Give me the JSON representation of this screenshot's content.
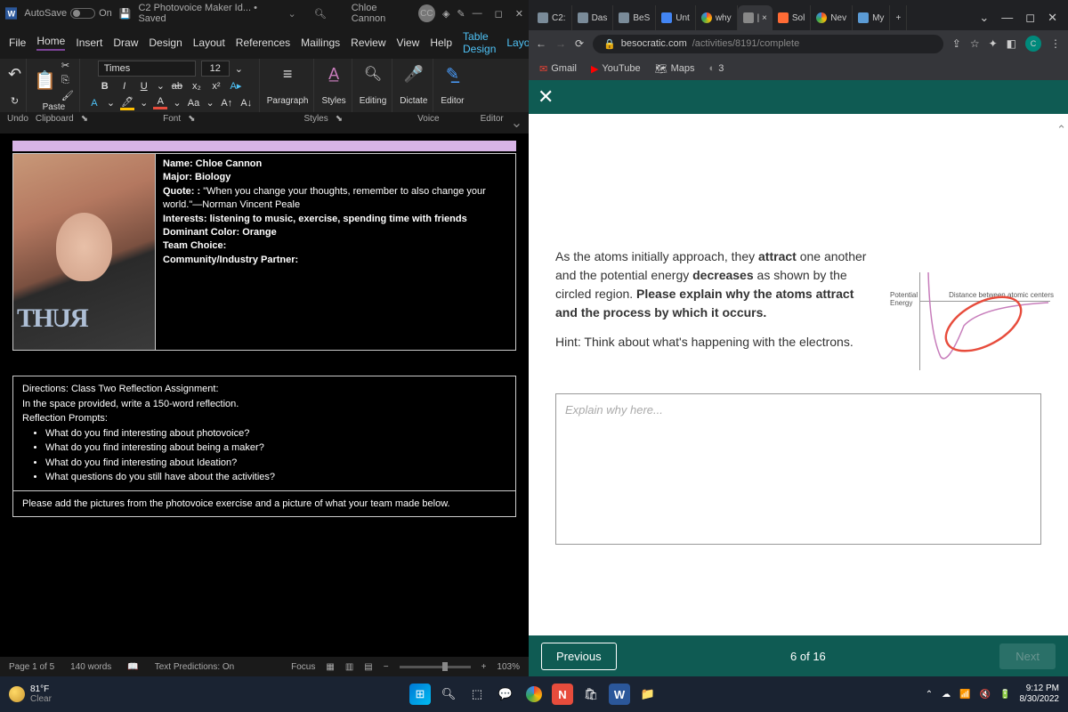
{
  "word": {
    "titlebar": {
      "autosave_label": "AutoSave",
      "autosave_state": "On",
      "doc_title": "C2 Photovoice Maker Id... • Saved",
      "user": "Chloe Cannon",
      "initials": "CC"
    },
    "menu": [
      "File",
      "Home",
      "Insert",
      "Draw",
      "Design",
      "Layout",
      "References",
      "Mailings",
      "Review",
      "View",
      "Help",
      "Table Design",
      "Layout"
    ],
    "active_tab": "Home",
    "font": {
      "name": "Times",
      "size": "12"
    },
    "ribbon_groups": [
      "Paste",
      "Paragraph",
      "Styles",
      "Editing",
      "Dictate",
      "Editor"
    ],
    "group_labels": [
      "Undo",
      "Clipboard",
      "Font",
      "Styles",
      "Voice",
      "Editor"
    ],
    "doc": {
      "name_line": "Name: Chloe Cannon",
      "major_line": "Major: Biology",
      "quote_label": "Quote: :",
      "quote_text": "\"When you change your thoughts, remember to also change your world.\"—Norman Vincent Peale",
      "interests": "Interests: listening to music, exercise, spending time with friends",
      "color": "Dominant Color: Orange",
      "team": "Team Choice:",
      "partner": "Community/Industry Partner:",
      "shirt_text": "RUHT",
      "directions_title": "Directions: Class Two Reflection Assignment:",
      "directions_sub": "In the space provided, write a 150-word reflection.",
      "prompts_label": "Reflection Prompts:",
      "prompts": [
        "What do you find interesting about photovoice?",
        "What do you find interesting about being a maker?",
        "What do you find interesting about Ideation?",
        "What questions do you still have about the activities?"
      ],
      "below": "Please add the pictures from the photovoice exercise and a picture of what your team made below."
    },
    "status": {
      "page": "Page 1 of 5",
      "words": "140 words",
      "predictions": "Text Predictions: On",
      "focus": "Focus",
      "zoom": "103%"
    }
  },
  "chrome": {
    "tabs": [
      {
        "label": "C2:",
        "fav": "#7a8b99"
      },
      {
        "label": "Das",
        "fav": "#7a8b99"
      },
      {
        "label": "BeS",
        "fav": "#7a8b99"
      },
      {
        "label": "Unt",
        "fav": "#4285f4"
      },
      {
        "label": "why",
        "fav": "#ea4335",
        "g": true
      },
      {
        "label": "| ×",
        "fav": "#888"
      },
      {
        "label": "Sol",
        "fav": "#ff6b35"
      },
      {
        "label": "Nev",
        "fav": "#ea4335",
        "g": true
      },
      {
        "label": "My",
        "fav": "#5b9bd5"
      }
    ],
    "active_tab_idx": 5,
    "url_host": "besocratic.com",
    "url_path": "/activities/8191/complete",
    "bookmarks": [
      "Gmail",
      "YouTube",
      "Maps",
      "3"
    ],
    "question_p1_a": "As the atoms initially approach, they ",
    "question_p1_b": "attract",
    "question_p1_c": " one another and the potential energy ",
    "question_p1_d": "decreases",
    "question_p1_e": " as shown by the circled region. ",
    "question_p1_f": "Please explain why the atoms attract and the process by which it occurs.",
    "hint": "Hint: Think about what's happening with the electrons.",
    "graph": {
      "ylabel1": "Potential",
      "ylabel2": "Energy",
      "xlabel": "Distance between atomic centers"
    },
    "placeholder": "Explain why here...",
    "nav": {
      "prev": "Previous",
      "pos": "6 of 16",
      "next": "Next"
    }
  },
  "taskbar": {
    "temp": "81°F",
    "cond": "Clear",
    "time": "9:12 PM",
    "date": "8/30/2022"
  }
}
